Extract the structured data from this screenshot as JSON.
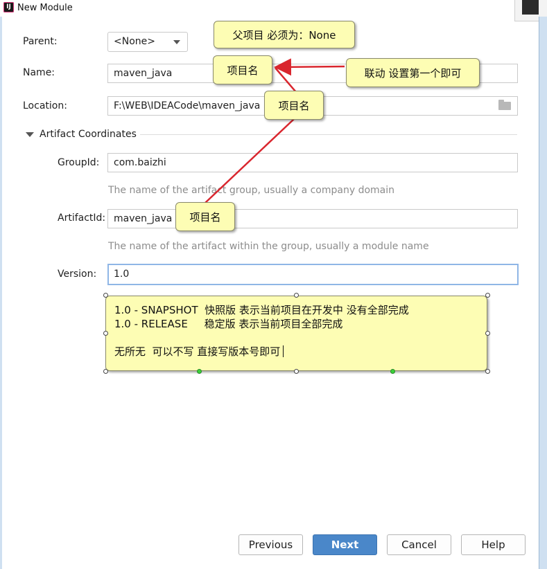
{
  "window": {
    "title": "New Module",
    "app_icon_text": "IJ"
  },
  "form": {
    "parent_label": "Parent:",
    "parent_value": "<None>",
    "name_label": "Name:",
    "name_value": "maven_java",
    "location_label": "Location:",
    "location_value": "F:\\WEB\\IDEACode\\maven_java",
    "section_label": "Artifact Coordinates",
    "groupid_label": "GroupId:",
    "groupid_value": "com.baizhi",
    "groupid_hint": "The name of the artifact group, usually a company domain",
    "artifactid_label": "ArtifactId:",
    "artifactid_value": "maven_java",
    "artifactid_hint": "The name of the artifact within the group, usually a module name",
    "version_label": "Version:",
    "version_value": "1.0"
  },
  "annotations": {
    "parent_note": "父项目 必须为：None",
    "name_note": "项目名",
    "linkage_note": "联动 设置第一个即可",
    "location_note": "项目名",
    "artifact_note": "项目名",
    "version_lines": [
      "1.0 - SNAPSHOT  快照版 表示当前项目在开发中 没有全部完成",
      "1.0 - RELEASE     稳定版 表示当前项目全部完成",
      "",
      "无所无  可以不写 直接写版本号即可"
    ]
  },
  "buttons": {
    "previous": "Previous",
    "next": "Next",
    "cancel": "Cancel",
    "help": "Help"
  },
  "colors": {
    "accent": "#4a87c9",
    "note_bg": "#fdfdb4",
    "arrow": "#d9262e"
  }
}
